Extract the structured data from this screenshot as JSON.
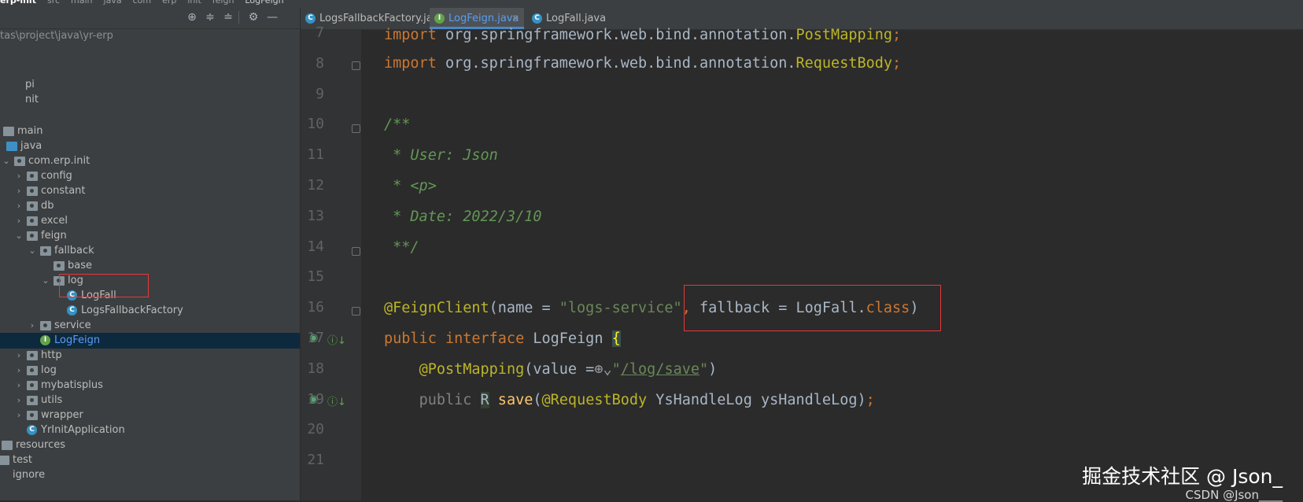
{
  "breadcrumb": {
    "items": [
      "erp-init",
      "src",
      "main",
      "java",
      "com",
      "erp",
      "init",
      "feign",
      "LogFeign"
    ]
  },
  "project": {
    "path": "tas\\project\\java\\yr-erp",
    "tree": [
      {
        "label": "pi",
        "icon": "module-icon"
      },
      {
        "label": "nit",
        "icon": "module-icon"
      },
      {
        "label": "main",
        "icon": "folder-icon"
      },
      {
        "label": "java",
        "icon": "source-folder-icon"
      },
      {
        "label": "com.erp.init",
        "icon": "package-icon"
      },
      {
        "label": "config",
        "icon": "package-icon"
      },
      {
        "label": "constant",
        "icon": "package-icon"
      },
      {
        "label": "db",
        "icon": "package-icon"
      },
      {
        "label": "excel",
        "icon": "package-icon"
      },
      {
        "label": "feign",
        "icon": "package-icon"
      },
      {
        "label": "fallback",
        "icon": "package-icon"
      },
      {
        "label": "base",
        "icon": "package-icon"
      },
      {
        "label": "log",
        "icon": "package-icon"
      },
      {
        "label": "LogFall",
        "icon": "class-icon"
      },
      {
        "label": "LogsFallbackFactory",
        "icon": "class-icon"
      },
      {
        "label": "service",
        "icon": "package-icon"
      },
      {
        "label": "LogFeign",
        "icon": "interface-icon"
      },
      {
        "label": "http",
        "icon": "package-icon"
      },
      {
        "label": "log",
        "icon": "package-icon"
      },
      {
        "label": "mybatisplus",
        "icon": "package-icon"
      },
      {
        "label": "utils",
        "icon": "package-icon"
      },
      {
        "label": "wrapper",
        "icon": "package-icon"
      },
      {
        "label": "YrInitApplication",
        "icon": "spring-class-icon"
      },
      {
        "label": "resources",
        "icon": "folder-icon"
      },
      {
        "label": "test",
        "icon": "folder-icon"
      },
      {
        "label": "ignore",
        "icon": "file-icon"
      }
    ]
  },
  "tabs": [
    {
      "label": "LogsFallbackFactory.java",
      "icon": "C",
      "active": false
    },
    {
      "label": "LogFeign.java",
      "icon": "I",
      "active": true
    },
    {
      "label": "LogFall.java",
      "icon": "C",
      "active": false
    }
  ],
  "editor": {
    "line_numbers": [
      "7",
      "8",
      "9",
      "10",
      "11",
      "12",
      "13",
      "14",
      "15",
      "16",
      "17",
      "18",
      "19",
      "20",
      "21"
    ],
    "lines": {
      "l7_kw": "import ",
      "l7_pkg": "org.springframework.web.bind.annotation.",
      "l7_cls": "PostMapping",
      "l7_end": ";",
      "l8_kw": "import ",
      "l8_pkg": "org.springframework.web.bind.annotation.",
      "l8_cls": "RequestBody",
      "l8_end": ";",
      "l10": "/**",
      "l11": " * User: Json",
      "l12": " * <p>",
      "l13": " * Date: 2022/3/10",
      "l14": " **/",
      "l16_ann": "@FeignClient",
      "l16_a": "(name = ",
      "l16_str": "\"logs-service\"",
      "l16_comma": ", ",
      "l16_fb": "fallback = LogFall.",
      "l16_class": "class",
      "l16_end": ")",
      "l17_kw1": "public ",
      "l17_kw2": "interface ",
      "l17_name": "LogFeign ",
      "l17_brace": "{",
      "l18_ann": "@PostMapping",
      "l18_a": "(value =",
      "l18_q": "\"",
      "l18_url": "/log/save",
      "l18_q2": "\"",
      "l18_end": ")",
      "l19_kw": "public ",
      "l19_r": "R",
      "l19_fn": " save",
      "l19_a": "(",
      "l19_ann": "@RequestBody",
      "l19_b": " YsHandleLog ysHandleLog)",
      "l19_end": ";"
    }
  },
  "watermark": {
    "main": "掘金技术社区 @ Json_",
    "sub": "CSDN @Json____"
  },
  "colors": {
    "selection": "#0d293e",
    "highlight_box": "#e5383b",
    "accent_tab": "#4a88c7"
  }
}
